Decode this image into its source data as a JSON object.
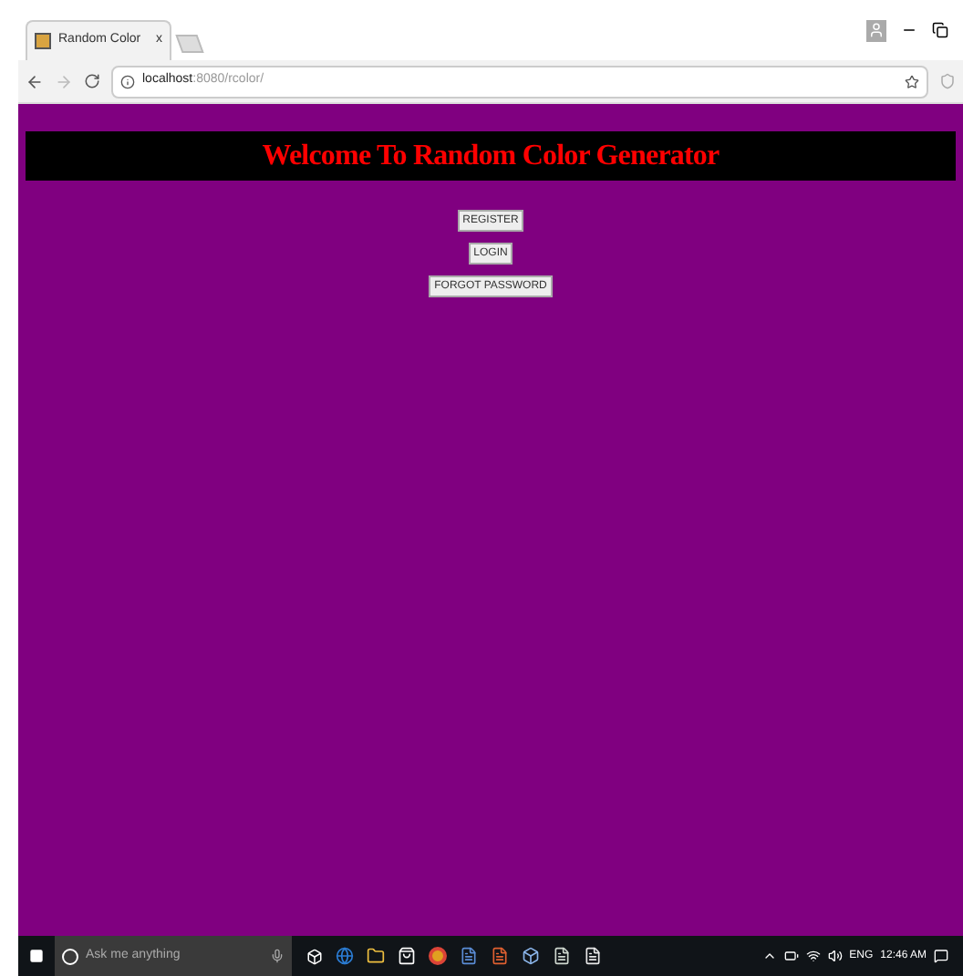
{
  "browser": {
    "tab_title": "Random Color",
    "tab_close": "x",
    "url_host": "localhost",
    "url_path": ":8080/rcolor/"
  },
  "page": {
    "heading": "Welcome To Random Color Generator",
    "buttons": [
      "REGISTER",
      "LOGIN",
      "FORGOT PASSWORD"
    ]
  },
  "taskbar": {
    "search_placeholder": "Ask me anything",
    "language": "ENG",
    "time": "12:46 AM"
  }
}
